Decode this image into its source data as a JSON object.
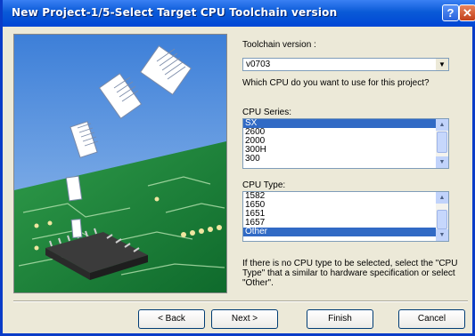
{
  "window": {
    "title": "New Project-1/5-Select Target CPU Toolchain version",
    "help": "?",
    "close": "✕"
  },
  "toolchain": {
    "label": "Toolchain version :",
    "value": "v0703"
  },
  "question": "Which CPU do you want to use for this project?",
  "cpu_series": {
    "label": "CPU Series:",
    "items": [
      "SX",
      "2600",
      "2000",
      "300H",
      "300"
    ],
    "selected": "SX"
  },
  "cpu_type": {
    "label": "CPU Type:",
    "items": [
      "1582",
      "1650",
      "1651",
      "1657",
      "Other"
    ],
    "selected": "Other"
  },
  "hint": "If there is no CPU type to be selected, select the \"CPU Type\" that a similar to hardware specification or select \"Other\".",
  "buttons": {
    "back": "< Back",
    "next": "Next >",
    "finish": "Finish",
    "cancel": "Cancel"
  }
}
